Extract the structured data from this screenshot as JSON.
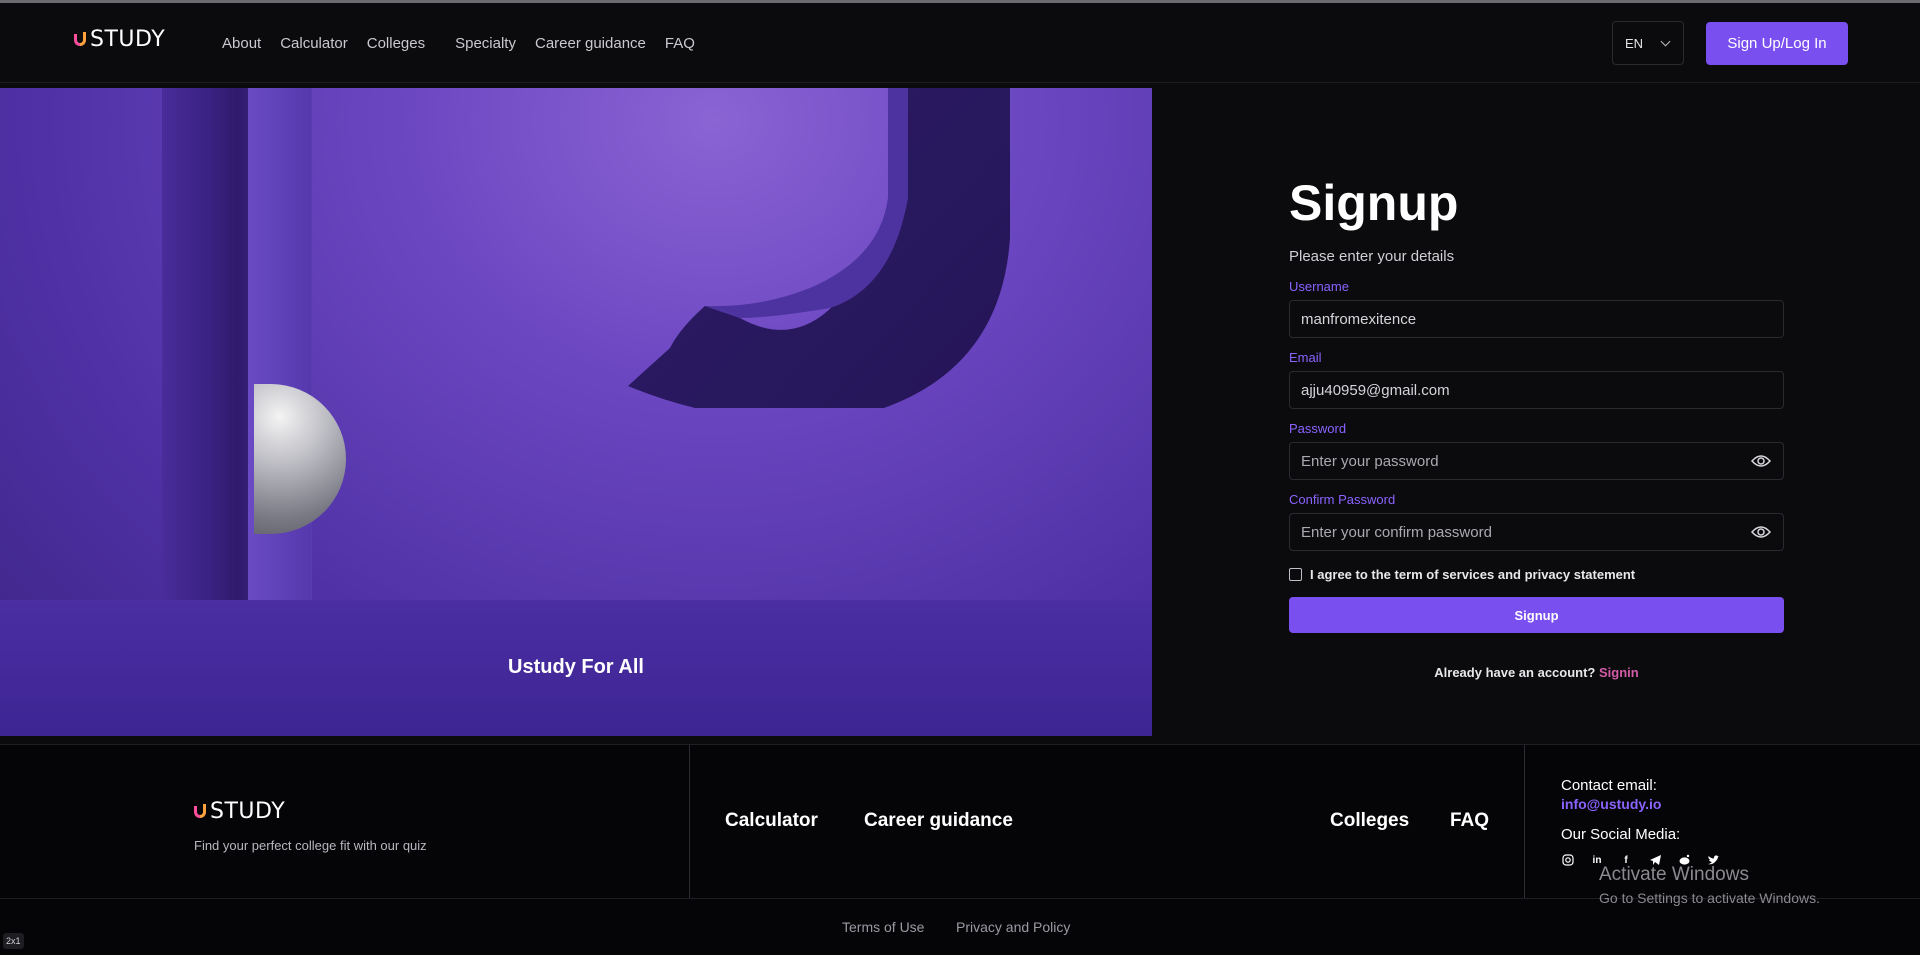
{
  "nav": {
    "logo_text": "STUDY",
    "links": [
      "About",
      "Calculator",
      "Colleges",
      "Specialty",
      "Career guidance",
      "FAQ"
    ],
    "language": "EN",
    "cta_label": "Sign Up/Log In"
  },
  "hero": {
    "caption": "Ustudy For All"
  },
  "form": {
    "title": "Signup",
    "subtitle": "Please enter your details",
    "username_label": "Username",
    "username_value": "manfromexitence",
    "email_label": "Email",
    "email_value": "ajju40959@gmail.com",
    "password_label": "Password",
    "password_placeholder": "Enter your password",
    "confirm_label": "Confirm Password",
    "confirm_placeholder": "Enter your confirm password",
    "agree_text": "I agree to the term of services and privacy statement",
    "submit_label": "Signup",
    "have_account_text": "Already have an account?",
    "signin_link": "Signin"
  },
  "footer": {
    "logo_text": "STUDY",
    "tagline": "Find your perfect college fit with our quiz",
    "links": [
      "Calculator",
      "Career guidance",
      "Colleges",
      "FAQ"
    ],
    "contact_label": "Contact email:",
    "contact_email": "info@ustudy.io",
    "social_label": "Our Social Media:",
    "social_icons": [
      "instagram-icon",
      "linkedin-icon",
      "facebook-icon",
      "telegram-icon",
      "reddit-icon",
      "twitter-icon"
    ],
    "terms": "Terms of Use",
    "privacy": "Privacy and Policy"
  },
  "overlay": {
    "activate_title": "Activate Windows",
    "activate_sub": "Go to Settings to activate Windows.",
    "badge": "2x1"
  },
  "colors": {
    "accent": "#7a4ff0",
    "label": "#8b63ff",
    "signin_link": "#d35ca8",
    "background": "#0b0b0d"
  }
}
